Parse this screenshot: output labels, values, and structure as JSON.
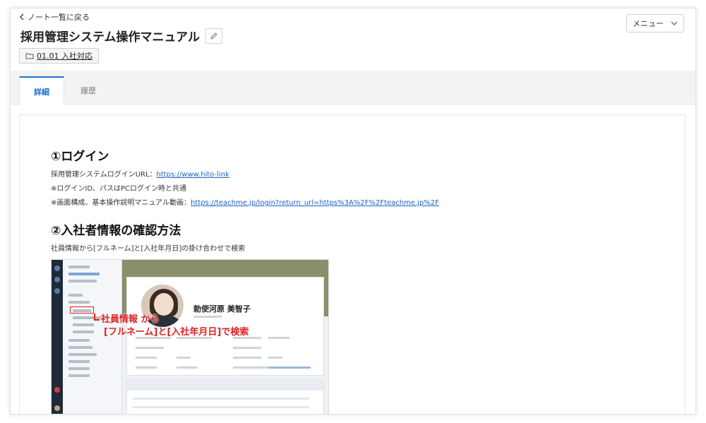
{
  "nav": {
    "back_label": "ノート一覧に戻る"
  },
  "header": {
    "title": "採用管理システム操作マニュアル",
    "folder_label": "01.01 入社対応",
    "menu_label": "メニュー"
  },
  "tabs": [
    {
      "label": "詳細",
      "active": true
    },
    {
      "label": "履歴",
      "active": false
    }
  ],
  "doc": {
    "section1": {
      "heading": "①ログイン",
      "line1_text": "採用管理システムログインURL：",
      "line1_link": "https://www.hito-link",
      "line2": "※ログインID、パスはPCログイン時と共通",
      "line3_text": "※画面構成、基本操作説明マニュアル動画：",
      "line3_link": "https://teachme.jp/login?return_url=https%3A%2F%2Fteachme.jp%2F"
    },
    "section2": {
      "heading": "②入社者情報の確認方法",
      "line1": "社員情報から[フルネーム]と[入社年月日]の掛け合わせで検索"
    },
    "screenshot": {
      "profile_name": "勅使河原 美智子",
      "callout_line1": "社員情報 から",
      "callout_line2": "[フルネーム]と[入社年月日]で検索"
    }
  },
  "colors": {
    "accent": "#1a73c8",
    "link": "#1a63c7",
    "callout": "#e02020"
  }
}
